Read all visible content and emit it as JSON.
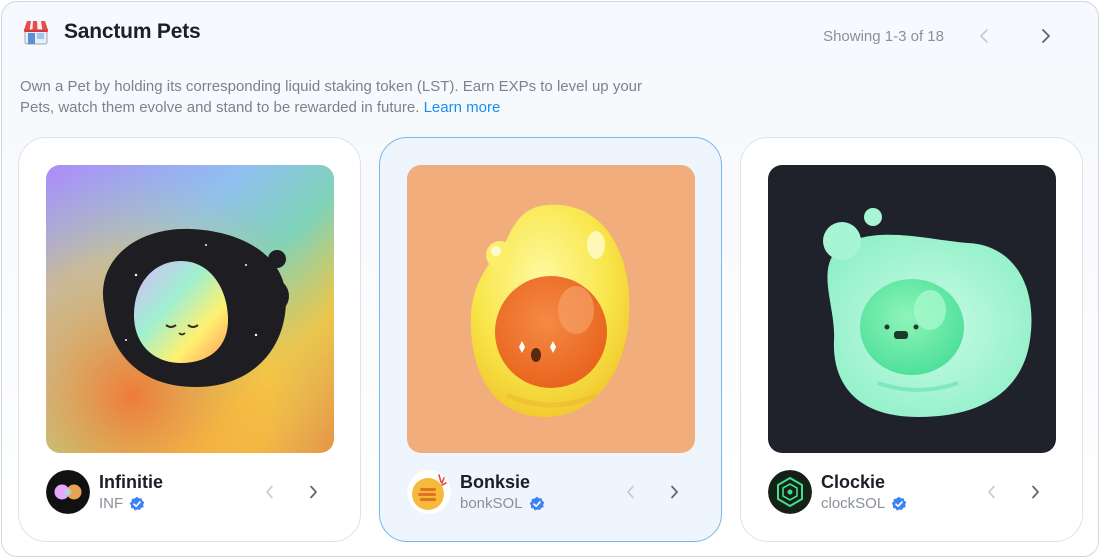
{
  "header": {
    "title": "Sanctum Pets",
    "icon": "shop-icon",
    "showing": "Showing 1-3 of 18"
  },
  "description": {
    "text": "Own a Pet by holding its corresponding liquid staking token (LST). Earn EXPs to level up your Pets, watch them evolve and stand to be rewarded in future.",
    "link": "Learn more"
  },
  "colors": {
    "link": "#1c8ef0",
    "verified": "#3b82f6",
    "selected_border": "#79b6ec"
  },
  "pets": [
    {
      "name": "Infinitie",
      "token": "INF",
      "verified": true,
      "art": "infinity-blob-art",
      "selected": false
    },
    {
      "name": "Bonksie",
      "token": "bonkSOL",
      "verified": true,
      "art": "bonk-blob-art",
      "selected": true
    },
    {
      "name": "Clockie",
      "token": "clockSOL",
      "verified": true,
      "art": "clock-blob-art",
      "selected": false
    }
  ]
}
